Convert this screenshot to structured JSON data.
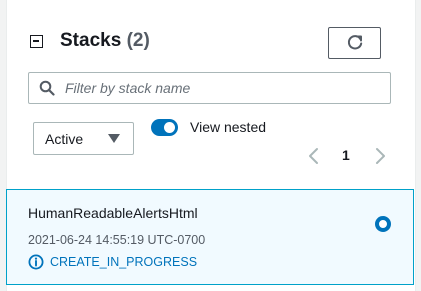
{
  "header": {
    "title": "Stacks",
    "count": "(2)"
  },
  "search": {
    "placeholder": "Filter by stack name",
    "value": ""
  },
  "filter": {
    "selected": "Active"
  },
  "nested_toggle": {
    "label": "View nested",
    "enabled": true
  },
  "pagination": {
    "current_page": "1"
  },
  "stacks": [
    {
      "name": "HumanReadableAlertsHtml",
      "timestamp": "2021-06-24 14:55:19 UTC-0700",
      "status": "CREATE_IN_PROGRESS",
      "selected": true
    }
  ],
  "colors": {
    "accent": "#0073bb",
    "selected_bg": "#f1faff",
    "selected_border": "#00a1c9",
    "text": "#16191f",
    "muted": "#545b64"
  },
  "icons": {
    "collapse": "minus-square-icon",
    "refresh": "refresh-icon",
    "search": "search-icon",
    "caret": "caret-down-icon",
    "prev": "chevron-left-icon",
    "next": "chevron-right-icon",
    "status": "info-circle-icon"
  }
}
